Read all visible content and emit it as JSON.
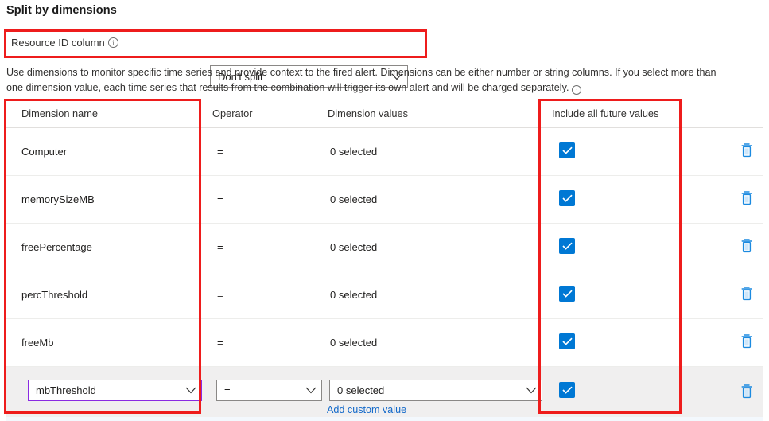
{
  "section": {
    "title": "Split by dimensions"
  },
  "resource_id": {
    "label": "Resource ID column",
    "info_glyph": "i",
    "selected": "Don't split",
    "icon": "info-icon"
  },
  "description": {
    "text": "Use dimensions to monitor specific time series and provide context to the fired alert. Dimensions can be either number or string columns. If you select more than one dimension value, each time series that results from the combination will trigger its own alert and will be charged separately.",
    "info_glyph": "i"
  },
  "table": {
    "headers": {
      "name": "Dimension name",
      "operator": "Operator",
      "values": "Dimension values",
      "include": "Include all future values"
    },
    "rows": [
      {
        "name": "Computer",
        "operator": "=",
        "values": "0 selected",
        "include_checked": true,
        "delete_icon": "trash-icon"
      },
      {
        "name": "memorySizeMB",
        "operator": "=",
        "values": "0 selected",
        "include_checked": true,
        "delete_icon": "trash-icon"
      },
      {
        "name": "freePercentage",
        "operator": "=",
        "values": "0 selected",
        "include_checked": true,
        "delete_icon": "trash-icon"
      },
      {
        "name": "percThreshold",
        "operator": "=",
        "values": "0 selected",
        "include_checked": true,
        "delete_icon": "trash-icon"
      },
      {
        "name": "freeMb",
        "operator": "=",
        "values": "0 selected",
        "include_checked": true,
        "delete_icon": "trash-icon"
      }
    ],
    "edit_row": {
      "name": "mbThreshold",
      "operator": "=",
      "values": "0 selected",
      "include_checked": true,
      "add_custom_value": "Add custom value",
      "delete_icon": "trash-icon"
    }
  },
  "colors": {
    "accent_blue": "#0078d4",
    "link_blue": "#1168c9",
    "annotation_red": "#ee1c1c",
    "focus_purple": "#8a2be2",
    "row_selected_bg": "#f0efef"
  }
}
